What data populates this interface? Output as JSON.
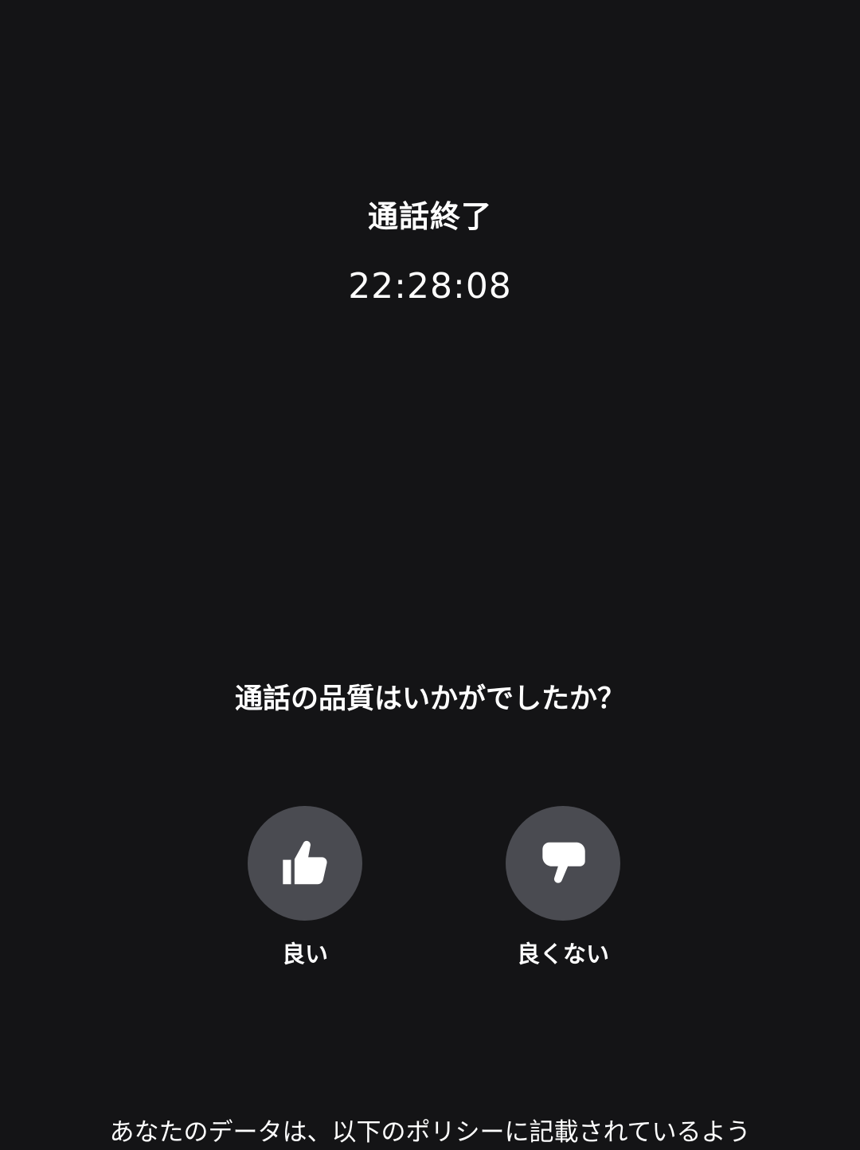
{
  "call": {
    "status": "通話終了",
    "time": "22:28:08"
  },
  "feedback": {
    "question": "通話の品質はいかがでしたか？",
    "good_label": "良い",
    "bad_label": "良くない",
    "button_color": "#4a4b51",
    "good_icon": "thumbs-up-icon",
    "bad_icon": "thumbs-down-icon"
  },
  "footer": {
    "privacy_text": "あなたのデータは、以下のポリシーに記載されているよう"
  },
  "colors": {
    "background": "#141416",
    "text": "#ffffff"
  }
}
